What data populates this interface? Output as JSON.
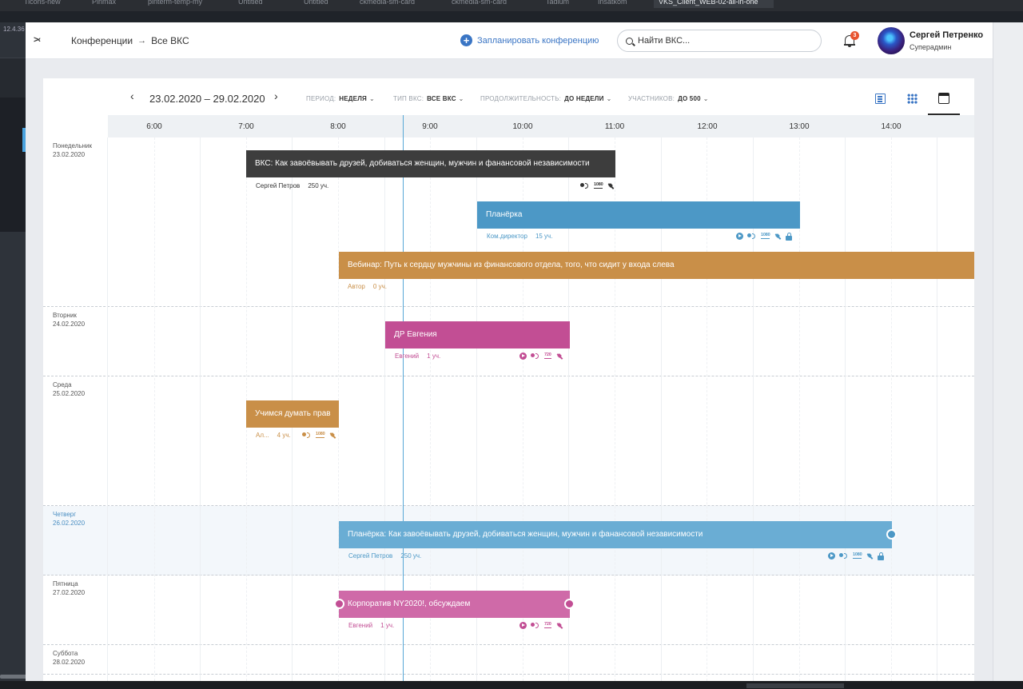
{
  "browser": {
    "version_label": "12.4.36",
    "tabs": [
      {
        "label": "Ticons-new",
        "active": false
      },
      {
        "label": "Pinmax",
        "active": false
      },
      {
        "label": "pinterm-temp-my",
        "active": false
      },
      {
        "label": "Untitled",
        "active": false
      },
      {
        "label": "Untitled",
        "active": false
      },
      {
        "label": "ckmedia-sm-card",
        "active": false
      },
      {
        "label": "ckmedia-sm-card",
        "active": false
      },
      {
        "label": "Tadium",
        "active": false
      },
      {
        "label": "Insatkom",
        "active": false
      },
      {
        "label": "VKS_Client_WEB-02-all-in-one",
        "active": true
      }
    ]
  },
  "header": {
    "collapse_label": ">‹",
    "breadcrumbs": [
      "Конференции",
      "Все ВКС"
    ],
    "crumb_separator": "→",
    "plan_button": "Запланировать конференцию",
    "search_placeholder": "Найти ВКС...",
    "notification_count": "3",
    "user_name": "Сергей Петренко",
    "user_role": "Суперадмин"
  },
  "toolbar": {
    "prev": "‹",
    "next": "›",
    "date_range": "23.02.2020 – 29.02.2020",
    "filters": [
      {
        "label": "ПЕРИОД:",
        "value": "НЕДЕЛЯ"
      },
      {
        "label": "ТИП ВКС:",
        "value": "ВСЕ ВКС"
      },
      {
        "label": "ПРОДОЛЖИТЕЛЬНОСТЬ:",
        "value": "ДО НЕДЕЛИ"
      },
      {
        "label": "УЧАСТНИКОВ:",
        "value": "ДО 500"
      }
    ],
    "chevron": "⌄",
    "views": [
      {
        "name": "list-view-icon",
        "active": false
      },
      {
        "name": "grid-view-icon",
        "active": false
      },
      {
        "name": "calendar-view-icon",
        "active": true
      }
    ]
  },
  "hours": [
    "6:00",
    "7:00",
    "8:00",
    "9:00",
    "10:00",
    "11:00",
    "12:00",
    "13:00",
    "14:00"
  ],
  "days": [
    {
      "name": "Понедельник",
      "date": "23.02.2020",
      "today": false
    },
    {
      "name": "Вторник",
      "date": "24.02.2020",
      "today": false
    },
    {
      "name": "Среда",
      "date": "25.02.2020",
      "today": false
    },
    {
      "name": "Четверг",
      "date": "26.02.2020",
      "today": true
    },
    {
      "name": "Пятница",
      "date": "27.02.2020",
      "today": false
    },
    {
      "name": "Суббота",
      "date": "28.02.2020",
      "today": false
    }
  ],
  "events": [
    {
      "title": "ВКС: Как завоёвывать друзей, добиваться женщин, мужчин и фанансовой независимости",
      "owner": "Сергей Петров",
      "participants": "250 уч.",
      "color": "#3d3d3d",
      "meta_color": "#333333",
      "icons": [
        "mic",
        "1080",
        "sat"
      ]
    },
    {
      "title": "Планёрка",
      "owner": "Ком.директор",
      "participants": "15 уч.",
      "color": "#4c98c6",
      "meta_color": "#4c98c6",
      "icons": [
        "play",
        "mic",
        "1080",
        "sat",
        "lock"
      ]
    },
    {
      "title": "Вебинар: Путь к сердцу мужчины из финансового отдела, того, что сидит у входа слева",
      "owner": "Автор",
      "participants": "0 уч.",
      "color": "#c98f48",
      "meta_color": "#c98f48",
      "icons": []
    },
    {
      "title": "ДР Евгения",
      "owner": "Евгений",
      "participants": "1 уч.",
      "color": "#c24e94",
      "meta_color": "#c24e94",
      "icons": [
        "play",
        "mic",
        "720",
        "sat"
      ]
    },
    {
      "title": "Учимся думать прав",
      "owner": "Ал...",
      "participants": "4 уч.",
      "color": "#c98f48",
      "meta_color": "#c98f48",
      "icons": [
        "mic",
        "1080",
        "sat"
      ]
    },
    {
      "title": "Планёрка: Как завоёвывать друзей, добиваться женщин, мужчин и фанансовой независимости",
      "owner": "Сергей Петров",
      "participants": "250 уч.",
      "color": "#6aadd4",
      "meta_color": "#4c98c6",
      "icons": [
        "play",
        "mic",
        "1080",
        "sat",
        "lock"
      ]
    },
    {
      "title": "Корпоратив NY2020!, обсуждаем",
      "owner": "Евгений",
      "participants": "1 уч.",
      "color": "#cf6aa8",
      "meta_color": "#c24e94",
      "icons": [
        "play",
        "mic",
        "720",
        "sat"
      ]
    }
  ]
}
